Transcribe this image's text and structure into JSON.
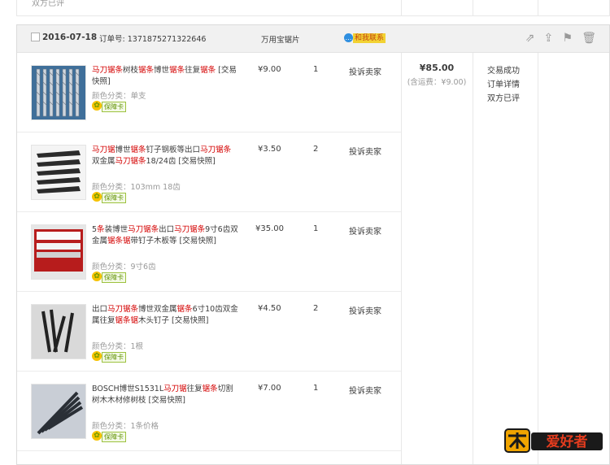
{
  "prev_order": {
    "text": "双方已评"
  },
  "order": {
    "date": "2016-07-18",
    "order_no_label": "订单号:",
    "order_no": "1371875271322646",
    "shop": "万用宝锯片",
    "contact_label": "和我联系",
    "contact_icon": "chat-bubble-icon",
    "total": "¥85.00",
    "shipping": "(含运费：¥9.00)",
    "status": [
      "交易成功",
      "订单详情",
      "双方已评"
    ],
    "header_icons": [
      "share-icon",
      "upload-icon",
      "flag-icon",
      "trash-icon"
    ]
  },
  "items": [
    {
      "title_parts": [
        [
          "马刀锯条",
          "hl"
        ],
        [
          "树枝",
          "n"
        ],
        [
          "锯条",
          "hl"
        ],
        [
          "博世",
          "n"
        ],
        [
          "锯条",
          "hl"
        ],
        [
          "往复",
          "n"
        ],
        [
          "锯条",
          "hl"
        ],
        [
          " [交易快照]",
          "n"
        ]
      ],
      "sku_label": "颜色分类：",
      "sku_value": "单支",
      "badge": "保障卡",
      "price": "¥9.00",
      "qty": "1",
      "complaint": "投诉卖家"
    },
    {
      "title_parts": [
        [
          "马刀锯",
          "hl"
        ],
        [
          "博世",
          "n"
        ],
        [
          "锯条",
          "hl"
        ],
        [
          "钉子钢板等出口",
          "n"
        ],
        [
          "马刀锯条",
          "hl"
        ],
        [
          "双金属",
          "n"
        ],
        [
          "马刀锯条",
          "hl"
        ],
        [
          "18/24齿 [交易快照]",
          "n"
        ]
      ],
      "sku_label": "颜色分类：",
      "sku_value": "103mm 18齿",
      "badge": "保障卡",
      "price": "¥3.50",
      "qty": "2",
      "complaint": "投诉卖家"
    },
    {
      "title_parts": [
        [
          "5",
          "n"
        ],
        [
          "条",
          "hl"
        ],
        [
          "装博世",
          "n"
        ],
        [
          "马刀锯条",
          "hl"
        ],
        [
          "出口",
          "n"
        ],
        [
          "马刀锯条",
          "hl"
        ],
        [
          "9寸6齿双金属",
          "n"
        ],
        [
          "锯条锯",
          "hl"
        ],
        [
          "带钉子木板等 [交易快照]",
          "n"
        ]
      ],
      "sku_label": "颜色分类：",
      "sku_value": "9寸6齿",
      "badge": "保障卡",
      "price": "¥35.00",
      "qty": "1",
      "complaint": "投诉卖家"
    },
    {
      "title_parts": [
        [
          "出口",
          "n"
        ],
        [
          "马刀锯条",
          "hl"
        ],
        [
          "博世双金属",
          "n"
        ],
        [
          "锯条",
          "hl"
        ],
        [
          "6寸10齿双金属往复",
          "n"
        ],
        [
          "锯条锯",
          "hl"
        ],
        [
          "木头钉子 [交易快照]",
          "n"
        ]
      ],
      "sku_label": "颜色分类：",
      "sku_value": "1根",
      "badge": "保障卡",
      "price": "¥4.50",
      "qty": "2",
      "complaint": "投诉卖家"
    },
    {
      "title_parts": [
        [
          "BOSCH博世S1531L",
          "n"
        ],
        [
          "马刀锯",
          "hl"
        ],
        [
          "往复",
          "n"
        ],
        [
          "锯条",
          "hl"
        ],
        [
          "切割树木木材修树枝 [交易快照]",
          "n"
        ]
      ],
      "sku_label": "颜色分类：",
      "sku_value": "1条价格",
      "badge": "保障卡",
      "price": "¥7.00",
      "qty": "1",
      "complaint": "投诉卖家"
    }
  ],
  "logo_text": "爱好者"
}
